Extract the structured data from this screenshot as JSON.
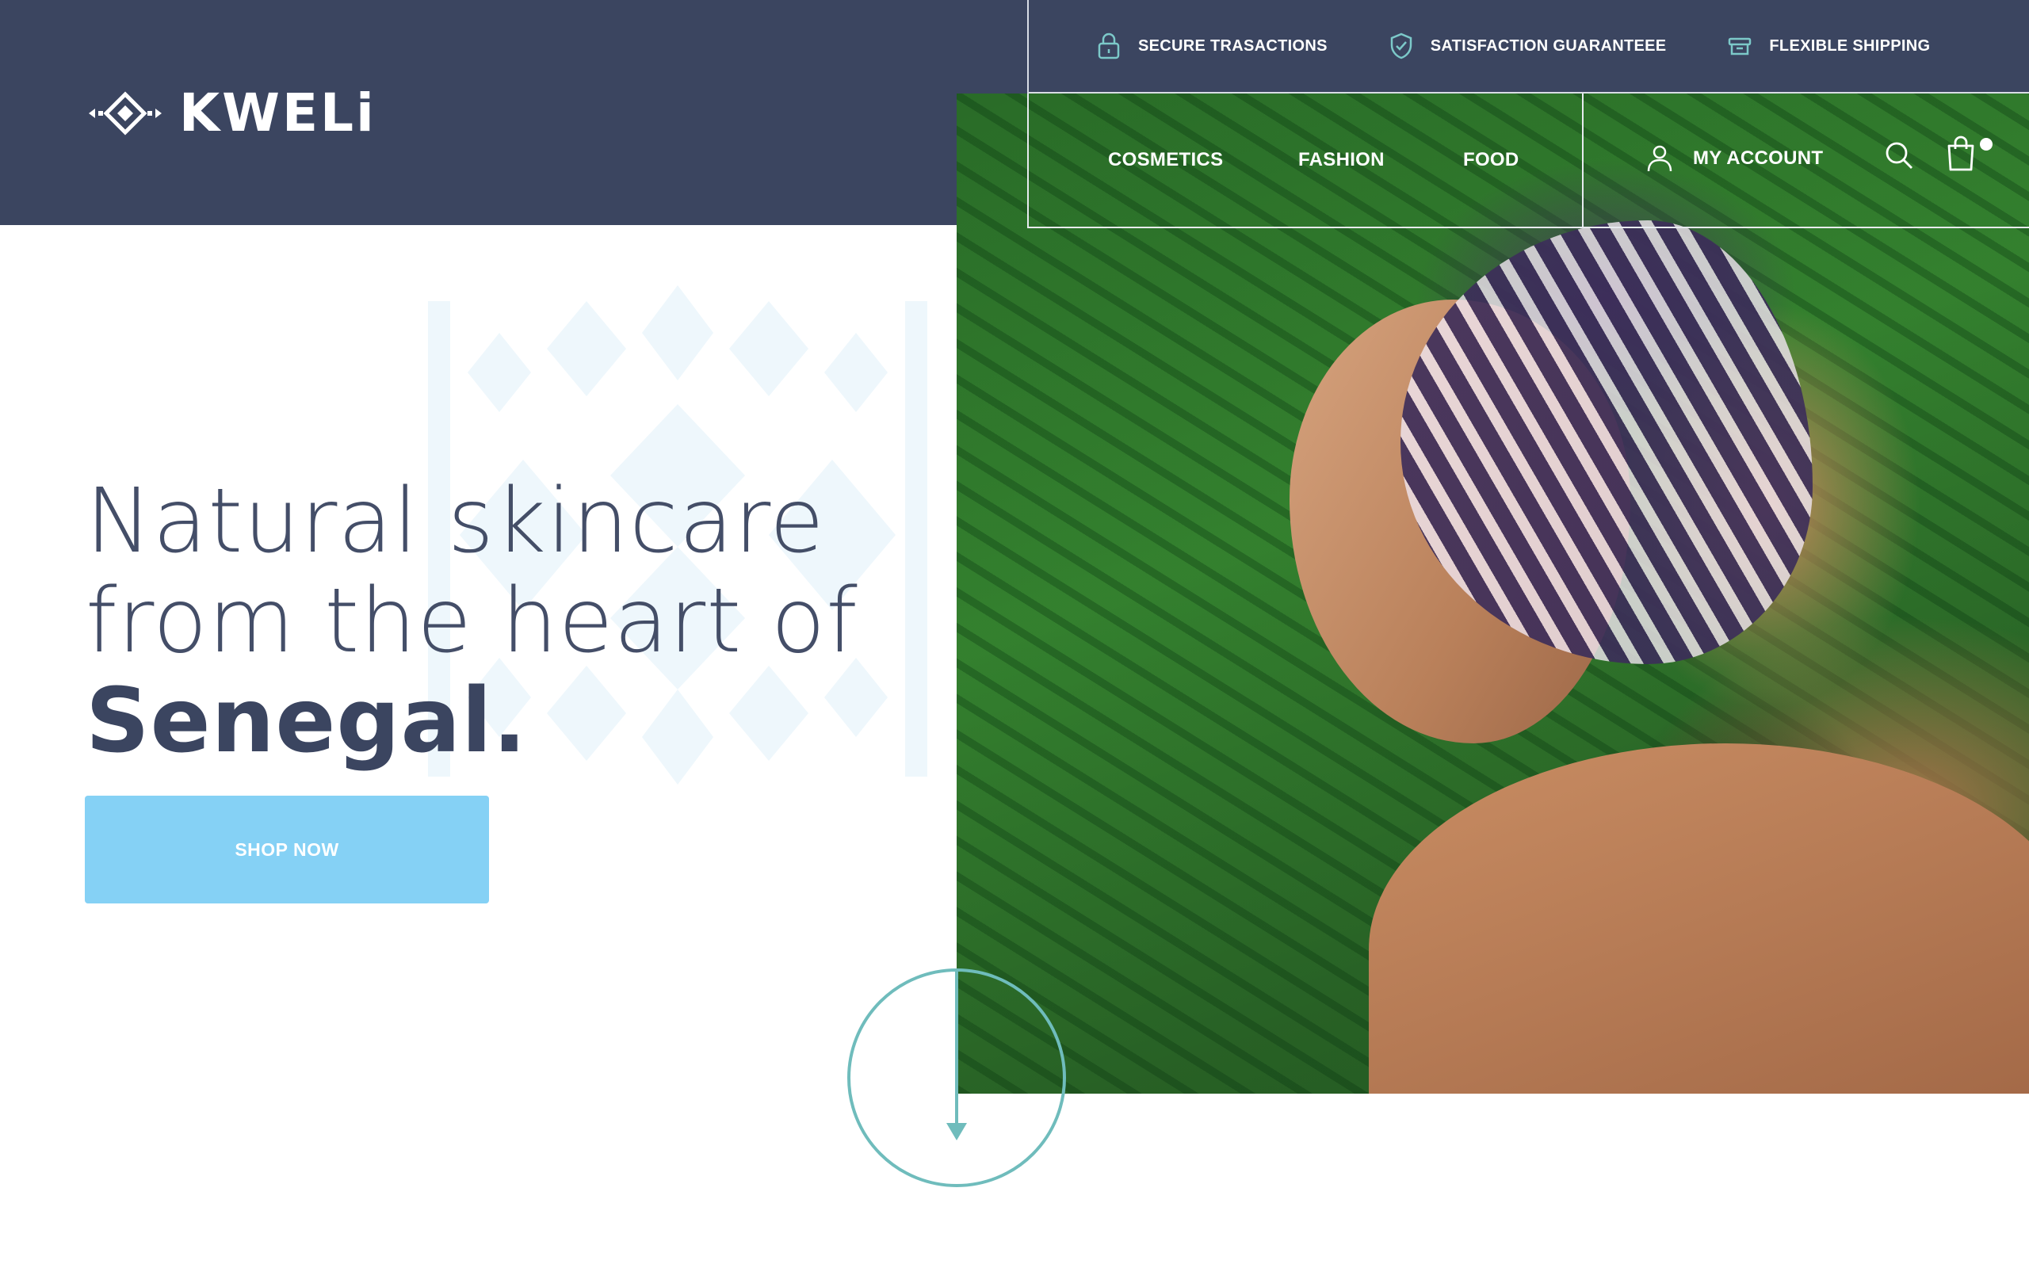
{
  "brand": {
    "name": "KWELi"
  },
  "infobar": {
    "items": [
      {
        "icon": "lock-icon",
        "label": "SECURE TRASACTIONS"
      },
      {
        "icon": "shield-check-icon",
        "label": "SATISFACTION GUARANTEEE"
      },
      {
        "icon": "box-icon",
        "label": "FLEXIBLE SHIPPING"
      }
    ]
  },
  "nav": {
    "items": [
      "COSMETICS",
      "FASHION",
      "FOOD"
    ],
    "account_label": "MY ACCOUNT",
    "icons": [
      "user-icon",
      "search-icon",
      "shopping-bag-icon"
    ]
  },
  "hero": {
    "line1": "Natural skincare",
    "line2": "from the heart of",
    "line3": "Senegal.",
    "cta_label": "SHOP NOW"
  },
  "colors": {
    "header_bg": "#3b4560",
    "accent_button": "#85d1f5",
    "scroll_circle": "#6fbcbc",
    "icon_teal": "#7cc9c9",
    "pattern": "#eef7fc"
  }
}
